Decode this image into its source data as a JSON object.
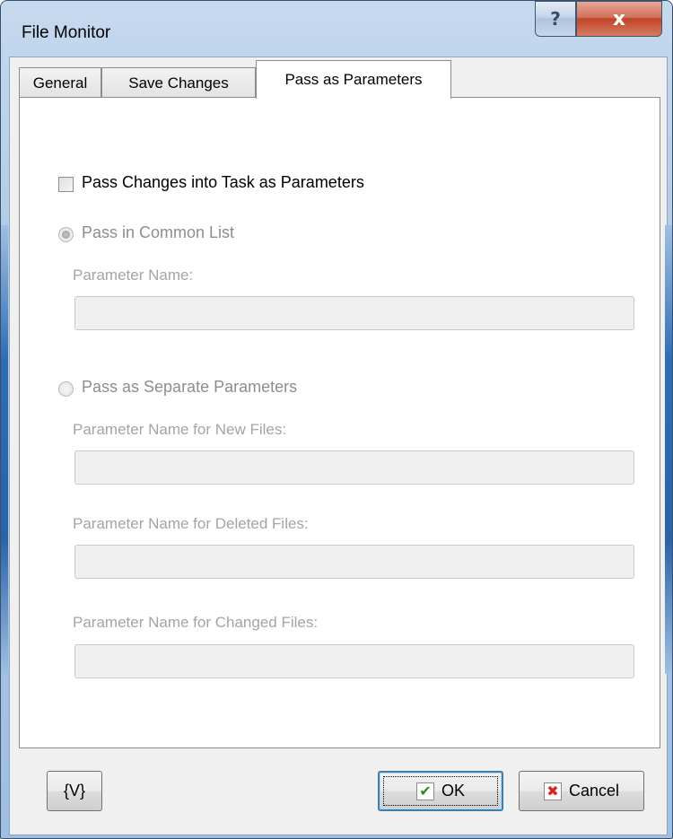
{
  "window": {
    "title": "File Monitor",
    "help_glyph": "?",
    "close_glyph": "x"
  },
  "tabs": [
    {
      "label": "General",
      "active": false
    },
    {
      "label": "Save Changes",
      "active": false
    },
    {
      "label": "Pass as Parameters",
      "active": true
    }
  ],
  "form": {
    "pass_changes": {
      "label": "Pass Changes into Task as Parameters",
      "checked": false
    },
    "common_list": {
      "label": "Pass in Common List",
      "selected": true,
      "enabled": false
    },
    "parameter_name": {
      "label": "Parameter Name:",
      "value": ""
    },
    "separate": {
      "label": "Pass as Separate Parameters",
      "selected": false,
      "enabled": false
    },
    "new_files": {
      "label": "Parameter Name for New Files:",
      "value": ""
    },
    "deleted_files": {
      "label": "Parameter Name for Deleted Files:",
      "value": ""
    },
    "changed_files": {
      "label": "Parameter Name for Changed Files:",
      "value": ""
    }
  },
  "buttons": {
    "variables": "{V}",
    "ok": "OK",
    "ok_glyph": "✔",
    "cancel": "Cancel",
    "cancel_glyph": "✖"
  }
}
